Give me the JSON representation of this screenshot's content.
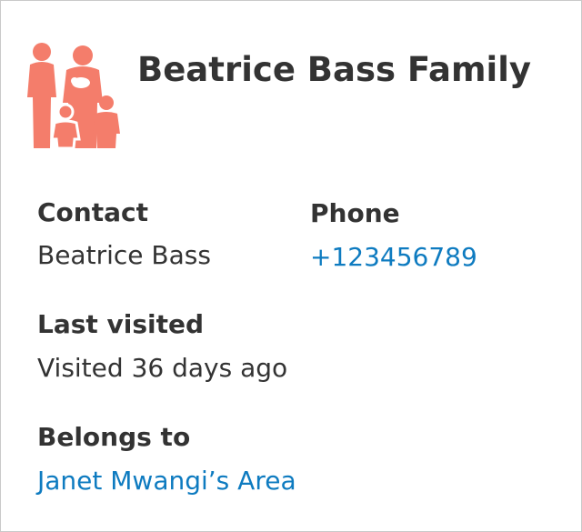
{
  "header": {
    "icon": "family-icon",
    "icon_color": "#f47d6b",
    "title": "Beatrice Bass Family"
  },
  "fields": {
    "contact": {
      "label": "Contact",
      "value": "Beatrice Bass"
    },
    "phone": {
      "label": "Phone",
      "value": "+123456789",
      "link_color": "#0e7bc0"
    },
    "last_visited": {
      "label": "Last visited",
      "value": "Visited 36 days ago"
    },
    "belongs_to": {
      "label": "Belongs to",
      "value": "Janet Mwangi’s Area",
      "link_color": "#0e7bc0"
    }
  }
}
